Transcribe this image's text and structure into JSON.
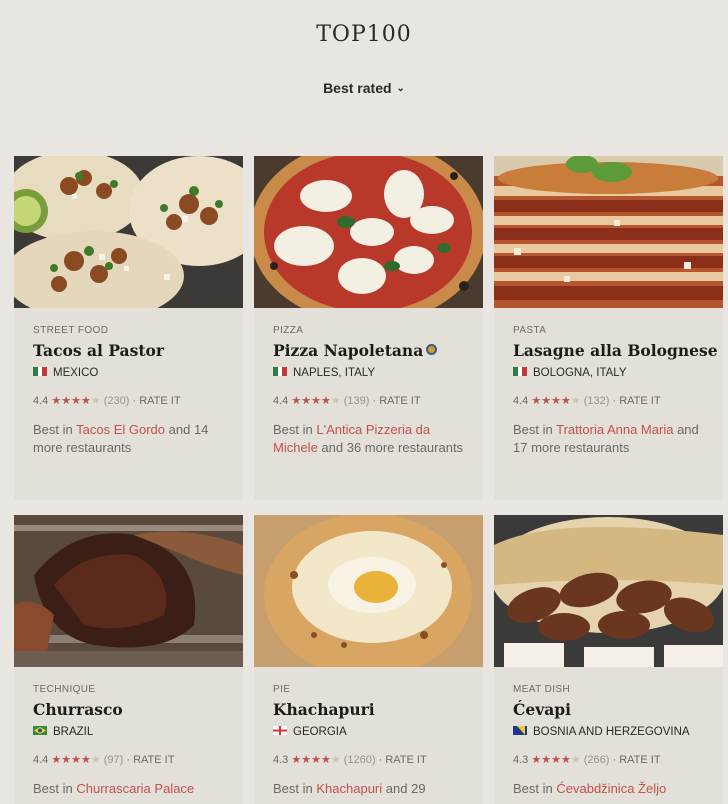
{
  "header": {
    "title": "TOP100",
    "sort_label": "Best rated"
  },
  "cards": [
    {
      "category": "STREET FOOD",
      "name": "Tacos al Pastor",
      "location": "MEXICO",
      "flag": "mexico",
      "score": "4.4",
      "stars": 4,
      "count": "(230)",
      "rate": "RATE IT",
      "best_prefix": "Best in",
      "best_place": "Tacos El Gordo",
      "best_suffix": "and 14 more restaurants"
    },
    {
      "category": "PIZZA",
      "name": "Pizza Napoletana",
      "location": "NAPLES, ITALY",
      "flag": "italy",
      "score": "4.4",
      "stars": 4,
      "count": "(139)",
      "rate": "RATE IT",
      "best_prefix": "Best in",
      "best_place": "L'Antica Pizzeria da Michele",
      "best_suffix": "and 36 more restaurants"
    },
    {
      "category": "PASTA",
      "name": "Lasagne alla Bolognese",
      "location": "BOLOGNA, ITALY",
      "flag": "italy",
      "score": "4.4",
      "stars": 4,
      "count": "(132)",
      "rate": "RATE IT",
      "best_prefix": "Best in",
      "best_place": "Trattoria Anna Maria",
      "best_suffix": "and 17 more restaurants"
    },
    {
      "category": "TECHNIQUE",
      "name": "Churrasco",
      "location": "BRAZIL",
      "flag": "brazil",
      "score": "4.4",
      "stars": 4,
      "count": "(97)",
      "rate": "RATE IT",
      "best_prefix": "Best in",
      "best_place": "Churrascaria Palace",
      "best_suffix": ""
    },
    {
      "category": "PIE",
      "name": "Khachapuri",
      "location": "GEORGIA",
      "flag": "georgia",
      "score": "4.3",
      "stars": 4,
      "count": "(1260)",
      "rate": "RATE IT",
      "best_prefix": "Best in",
      "best_place": "Khachapuri",
      "best_suffix": "and 29"
    },
    {
      "category": "MEAT DISH",
      "name": "Ćevapi",
      "location": "BOSNIA AND HERZEGOVINA",
      "flag": "bosnia",
      "score": "4.3",
      "stars": 4,
      "count": "(266)",
      "rate": "RATE IT",
      "best_prefix": "Best in",
      "best_place": "Ćevabdžinica Željo",
      "best_suffix": ""
    }
  ],
  "colors": {
    "background": "#e9e6e1",
    "card": "#e3dfd9",
    "accent": "#c4514a",
    "star": "#c0504a"
  },
  "icons": {
    "sort": "chevron-down-icon",
    "badge": "award-badge-icon",
    "star": "star-icon"
  }
}
